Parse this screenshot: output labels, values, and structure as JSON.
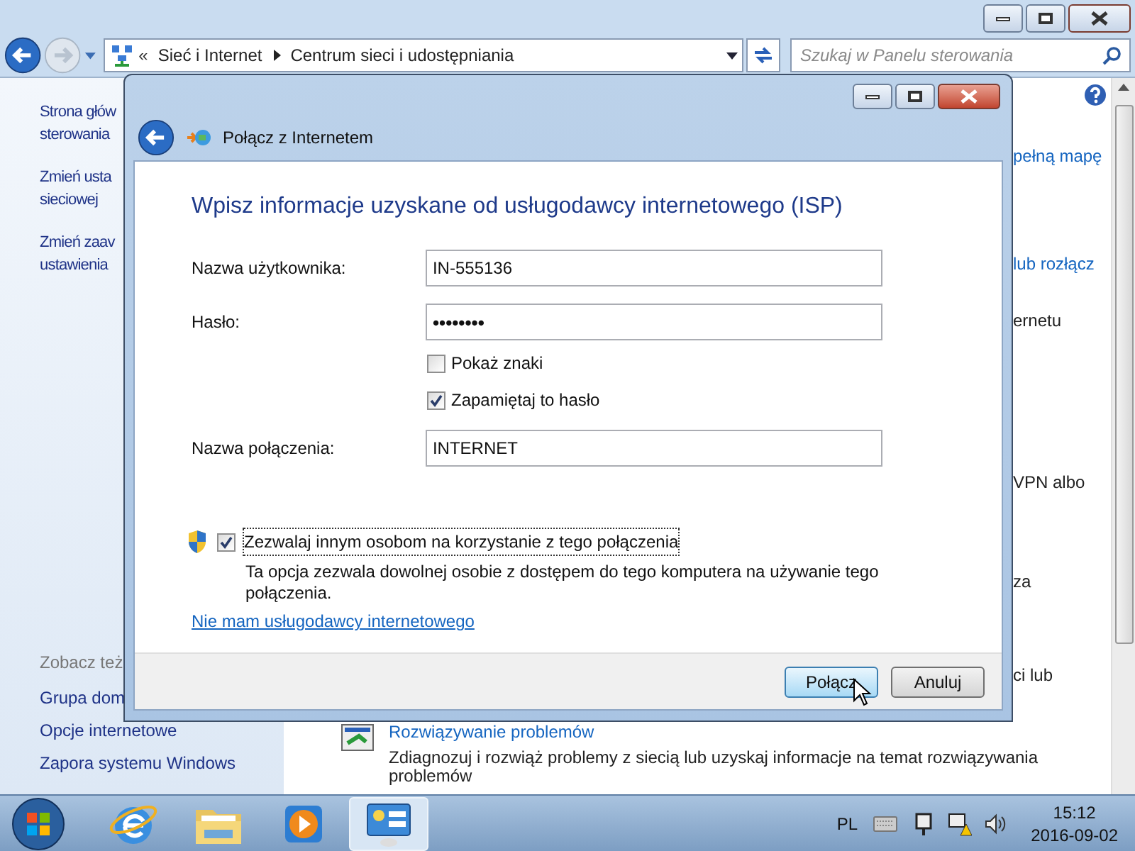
{
  "explorer": {
    "overflow_mark": "«",
    "breadcrumb": [
      "Sieć i Internet",
      "Centrum sieci i udostępniania"
    ],
    "search": {
      "placeholder": "Szukaj w Panelu sterowania"
    },
    "sidebar": {
      "links": [
        [
          "Strona głów",
          "sterowania"
        ],
        [
          "Zmień usta",
          "sieciowej"
        ],
        [
          "Zmień zaav",
          "ustawienia"
        ]
      ],
      "see_also_heading": "Zobacz też",
      "see_also": [
        "Grupa dom",
        "Opcje internetowe",
        "Zapora systemu Windows"
      ]
    },
    "main": {
      "right_fragments": [
        {
          "text": "pełną mapę",
          "kind": "link"
        },
        {
          "text": "lub rozłącz",
          "kind": "link"
        },
        {
          "text": "ernetu",
          "kind": "text"
        },
        {
          "text": "VPN albo",
          "kind": "text"
        },
        {
          "text": "za",
          "kind": "text"
        },
        {
          "text": "ci lub",
          "kind": "text"
        }
      ],
      "task": {
        "title": "Rozwiązywanie problemów",
        "description": "Zdiagnozuj i rozwiąż problemy z siecią lub uzyskaj informacje na temat rozwiązywania",
        "description_cut": "problemów"
      }
    }
  },
  "dialog": {
    "title": "Połącz z Internetem",
    "heading": "Wpisz informacje uzyskane od usługodawcy internetowego (ISP)",
    "username": {
      "label": "Nazwa użytkownika:",
      "value": "IN-555136"
    },
    "password": {
      "label": "Hasło:",
      "value": "••••••••"
    },
    "options": [
      {
        "label": "Pokaż znaki",
        "checked": false
      },
      {
        "label": "Zapamiętaj to hasło",
        "checked": true
      }
    ],
    "connection_name": {
      "label": "Nazwa połączenia:",
      "value": "INTERNET"
    },
    "share": {
      "label": "Zezwalaj innym osobom na korzystanie z tego połączenia",
      "checked": true,
      "focused": true,
      "description": "Ta opcja zezwala dowolnej osobie z dostępem do tego komputera na używanie tego połączenia."
    },
    "link": "Nie mam usługodawcy internetowego",
    "buttons": [
      {
        "label": "Połącz",
        "default": true
      },
      {
        "label": "Anuluj",
        "default": false
      }
    ]
  },
  "taskbar": {
    "items": [
      {
        "kind": "browser",
        "selected": false
      },
      {
        "kind": "folder",
        "selected": false
      },
      {
        "kind": "media",
        "selected": false
      },
      {
        "kind": "control-panel",
        "selected": true
      }
    ],
    "language": "PL",
    "time": "15:12",
    "date": "2016-09-02"
  }
}
